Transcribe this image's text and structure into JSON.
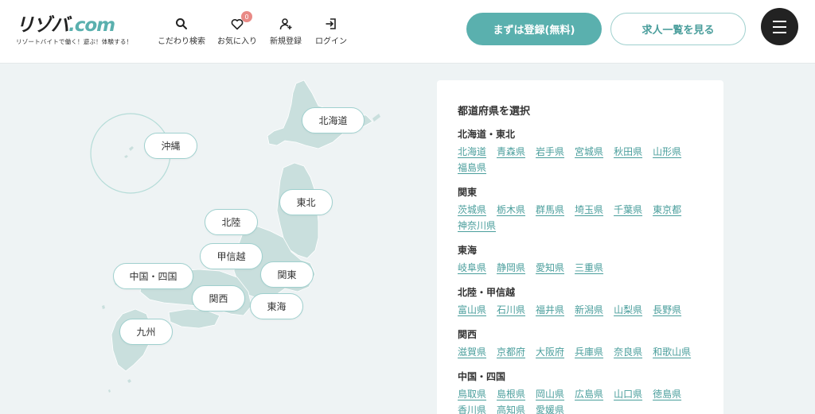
{
  "header": {
    "logo_text": "リゾバ",
    "logo_dot": ".com",
    "tagline": "リゾートバイトで働く！遊ぶ！体験する！",
    "nav": {
      "search": "こだわり検索",
      "favorites": "お気に入り",
      "favorites_count": "0",
      "register": "新規登録",
      "login": "ログイン"
    },
    "primary_button": "まずは登録(無料)",
    "secondary_button": "求人一覧を見る"
  },
  "map": {
    "regions": {
      "hokkaido": "北海道",
      "okinawa": "沖縄",
      "tohoku": "東北",
      "hokuriku": "北陸",
      "koshinetsu": "甲信越",
      "chugoku_shikoku": "中国・四国",
      "kanto": "関東",
      "kansai": "関西",
      "tokai": "東海",
      "kyushu": "九州"
    }
  },
  "panel": {
    "title": "都道府県を選択",
    "regions": [
      {
        "name": "北海道・東北",
        "prefs": [
          "北海道",
          "青森県",
          "岩手県",
          "宮城県",
          "秋田県",
          "山形県",
          "福島県"
        ]
      },
      {
        "name": "関東",
        "prefs": [
          "茨城県",
          "栃木県",
          "群馬県",
          "埼玉県",
          "千葉県",
          "東京都",
          "神奈川県"
        ]
      },
      {
        "name": "東海",
        "prefs": [
          "岐阜県",
          "静岡県",
          "愛知県",
          "三重県"
        ]
      },
      {
        "name": "北陸・甲信越",
        "prefs": [
          "富山県",
          "石川県",
          "福井県",
          "新潟県",
          "山梨県",
          "長野県"
        ]
      },
      {
        "name": "関西",
        "prefs": [
          "滋賀県",
          "京都府",
          "大阪府",
          "兵庫県",
          "奈良県",
          "和歌山県"
        ]
      },
      {
        "name": "中国・四国",
        "prefs": [
          "鳥取県",
          "島根県",
          "岡山県",
          "広島県",
          "山口県",
          "徳島県",
          "香川県",
          "高知県",
          "愛媛県"
        ]
      }
    ]
  },
  "colors": {
    "accent": "#5ab0ae",
    "link": "#4a9e9c",
    "map_fill": "#c9dfdd",
    "badge": "#e98a86",
    "background": "#eef3f4"
  }
}
